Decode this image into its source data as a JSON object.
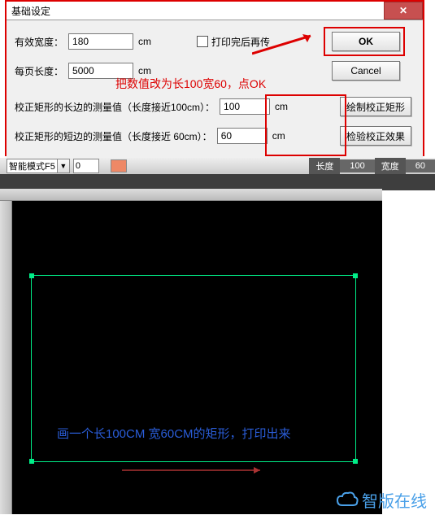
{
  "dialog": {
    "title": "基础设定",
    "close": "✕",
    "row1_label": "有效宽度：",
    "row1_value": "180",
    "row1_unit": "cm",
    "chk_label": "打印完后再传",
    "row2_label": "每页长度：",
    "row2_value": "5000",
    "row2_unit": "cm",
    "note": "把数值改为长100宽60，点OK",
    "m1_label": "校正矩形的长边的测量值（长度接近100cm）：",
    "m1_value": "100",
    "m1_unit": "cm",
    "m2_label": "校正矩形的短边的测量值（长度接近 60cm）：",
    "m2_value": "60",
    "m2_unit": "cm",
    "ok": "OK",
    "cancel": "Cancel",
    "btn_cal": "绘制校正矩形",
    "btn_test": "检验校正效果"
  },
  "toolbar": {
    "mode": "智能模式F5",
    "zero": "0",
    "len_lbl": "长度",
    "len_val": "100",
    "wid_lbl": "宽度",
    "wid_val": "60"
  },
  "canvas": {
    "text": "画一个长100CM 宽60CM的矩形，打印出来"
  },
  "watermark": "智版在线"
}
